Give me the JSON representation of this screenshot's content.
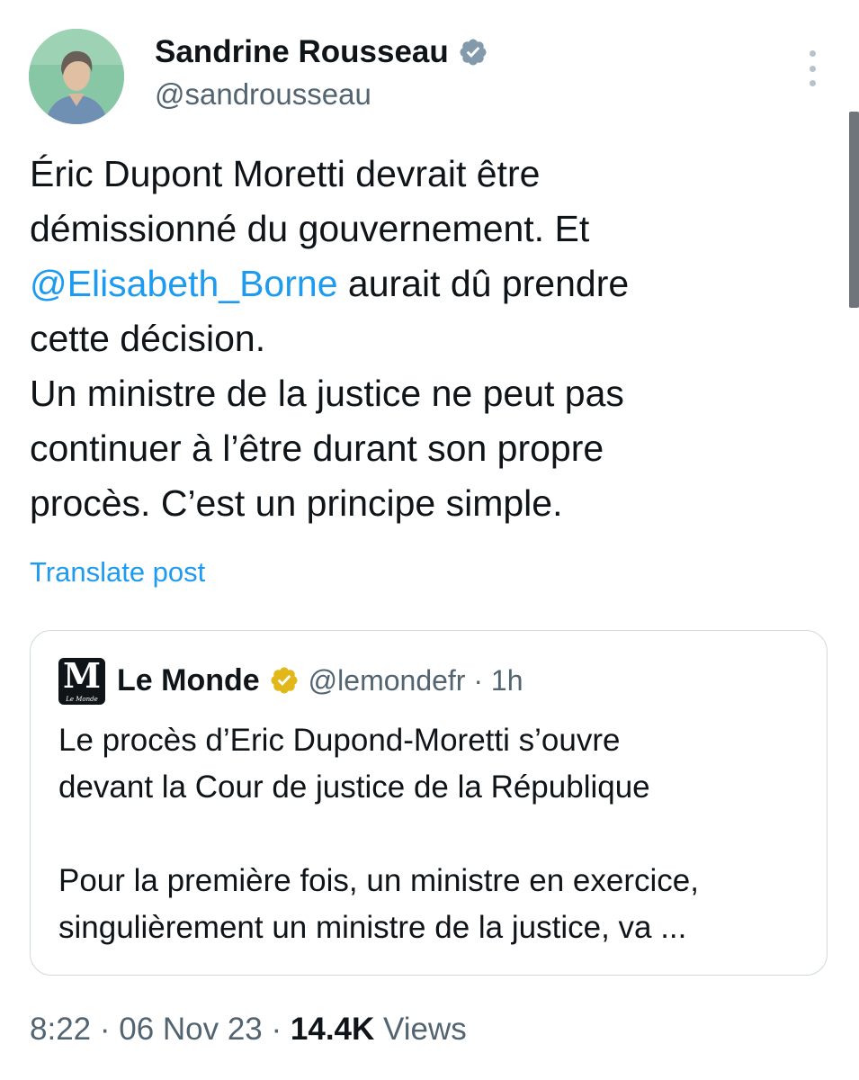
{
  "author": {
    "name": "Sandrine Rousseau",
    "handle": "@sandrousseau",
    "avatar_icon": "avatar-photo",
    "verified_icon": "verified-badge-gray"
  },
  "tweet": {
    "lines": [
      "Éric Dupont Moretti devrait être",
      "démissionné du gouvernement. Et",
      {
        "mention": "@Elisabeth_Borne",
        "rest": " aurait dû prendre"
      },
      "cette décision.",
      "Un ministre de la justice ne peut pas",
      "continuer à l’être durant son propre",
      "procès. C’est un principe simple."
    ],
    "translate_label": "Translate post"
  },
  "quote": {
    "logo_letter": "M",
    "logo_caption": "Le Monde",
    "name": "Le Monde",
    "verified_icon": "verified-badge-gold",
    "handle_time": "@lemondefr · 1h",
    "paragraph1": [
      "Le procès d’Eric Dupond-Moretti s’ouvre",
      "devant la Cour de justice de la République"
    ],
    "paragraph2": [
      "Pour la première fois, un ministre en exercice,",
      "singulièrement un ministre de la justice, va ..."
    ]
  },
  "meta": {
    "time_date": "8:22 · 06 Nov 23 · ",
    "views_count": "14.4K",
    "views_label": " Views"
  },
  "colors": {
    "link": "#1d9bf0",
    "secondary_text": "#536471",
    "primary_text": "#0f1419",
    "border": "#cfd9de",
    "gold_badge": "#e2b719",
    "gray_badge": "#829aab"
  }
}
